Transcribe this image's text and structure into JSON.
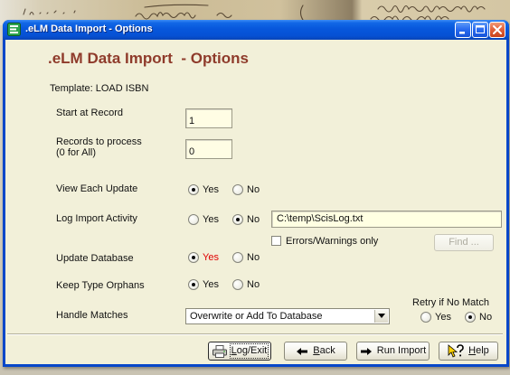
{
  "window": {
    "title": ".eLM Data Import - Options"
  },
  "icons": {
    "app": "elm-app-icon",
    "minimize": "minimize-icon",
    "maximize": "maximize-icon",
    "close": "close-icon",
    "log_exit": "printer-icon",
    "back": "back-arrow-icon",
    "run_import": "forward-arrow-icon",
    "help": "help-pointer-icon",
    "dropdown": "chevron-down-icon"
  },
  "colors": {
    "title_bar": "#0757dc",
    "heading": "#8f3b2b",
    "update_yes": "#e00000",
    "panel": "#f2f0d9"
  },
  "heading": ".eLM Data Import  - Options",
  "template_line": "Template: LOAD ISBN",
  "start_at_record": {
    "label": "Start at Record",
    "value": "1"
  },
  "records_to_process": {
    "label": "Records to process",
    "hint": "(0 for All)",
    "value": "0"
  },
  "view_each_update": {
    "label": "View Each Update",
    "yes": {
      "label": "Yes",
      "selected": true
    },
    "no": {
      "label": "No",
      "selected": false
    }
  },
  "log_import_activity": {
    "label": "Log Import Activity",
    "yes": {
      "label": "Yes",
      "selected": false
    },
    "no": {
      "label": "No",
      "selected": true
    },
    "log_file": "C:\\temp\\ScisLog.txt",
    "errors_only": {
      "label": "Errors/Warnings only",
      "checked": false
    },
    "find_button": {
      "label": "Find ...",
      "disabled": true
    }
  },
  "update_database": {
    "label": "Update Database",
    "yes": {
      "label": "Yes",
      "selected": true
    },
    "no": {
      "label": "No",
      "selected": false
    }
  },
  "keep_type_orphans": {
    "label": "Keep Type Orphans",
    "yes": {
      "label": "Yes",
      "selected": true
    },
    "no": {
      "label": "No",
      "selected": false
    }
  },
  "handle_matches": {
    "label": "Handle Matches",
    "selected_option": "Overwrite or Add To Database",
    "retry": {
      "label": "Retry if No Match",
      "yes": {
        "label": "Yes",
        "selected": false
      },
      "no": {
        "label": "No",
        "selected": true
      }
    }
  },
  "buttons": {
    "log_exit": {
      "label": "Log/Exit",
      "focused": true
    },
    "back": {
      "label": "Back"
    },
    "run_import": {
      "label": "Run Import"
    },
    "help": {
      "label": "Help"
    }
  }
}
